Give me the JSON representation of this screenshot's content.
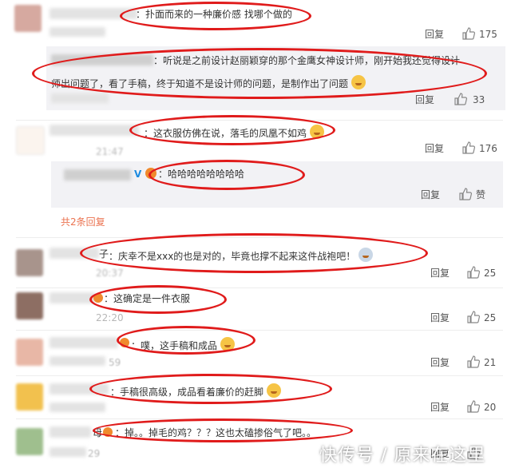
{
  "comments": [
    {
      "text": "：扑面而来的一种廉价感 找哪个做的",
      "reply_label": "回复",
      "likes": "175"
    },
    {
      "text_line1": "：听说是之前设计赵丽颖穿的那个金鹰女神设计师，刚开始我还觉得设计",
      "text_line2": "师出问题了，看了手稿，终于知道不是设计师的问题，是制作出了问题",
      "reply_label": "回复",
      "likes": "33"
    },
    {
      "text": "：这衣服仿佛在说，落毛的凤凰不如鸡",
      "time": "21:47",
      "reply_label": "回复",
      "likes": "176"
    },
    {
      "text": "：哈哈哈哈哈哈哈哈",
      "verified_badge": "V",
      "reply_label": "回复",
      "like_label": "赞"
    },
    {
      "author_tail": "子",
      "text": "：庆幸不是xxx的也是对的，毕竟也撑不起来这件战袍吧！",
      "time": "20:37",
      "reply_label": "回复",
      "likes": "25"
    },
    {
      "text": "：这确定是一件衣服",
      "time": "22:20",
      "reply_label": "回复",
      "likes": "25"
    },
    {
      "text": "：噗，这手稿和成品",
      "time": "59",
      "reply_label": "回复",
      "likes": "21"
    },
    {
      "text": "：手稿很高级，成品看着廉价的赶脚",
      "reply_label": "回复",
      "likes": "20"
    },
    {
      "author_tail": "母",
      "text": "：掉。。掉毛的鸡？？？这也太磕掺俗气了吧。。",
      "time": "29",
      "reply_label": "回复"
    }
  ],
  "thread_toggle": "共2条回复",
  "watermark": "快传号 / 原来在这里",
  "colors": {
    "highlight_oval": "#e01b1b",
    "reply_bg": "#f2f2f5",
    "link": "#eb7350"
  },
  "icons": [
    "thumbs-up-icon",
    "emoji-icon",
    "verified-icon"
  ]
}
